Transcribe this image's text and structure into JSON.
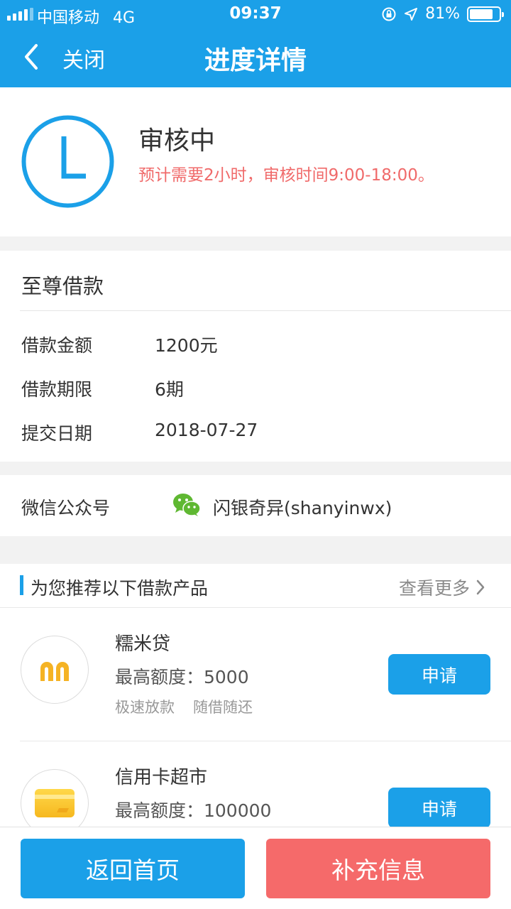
{
  "status_bar": {
    "carrier": "中国移动",
    "network": "4G",
    "time": "09:37",
    "battery": "81%",
    "battery_level": 0.81
  },
  "nav": {
    "close_label": "关闭",
    "title": "进度详情"
  },
  "status": {
    "title": "审核中",
    "note": "预计需要2小时，审核时间9:00-18:00。",
    "note_color": "#f06a6a"
  },
  "loan": {
    "title": "至尊借款",
    "rows": [
      {
        "label": "借款金额",
        "value": "1200元"
      },
      {
        "label": "借款期限",
        "value": "6期"
      },
      {
        "label": "提交日期",
        "value": "2018-07-27"
      }
    ]
  },
  "wechat": {
    "label": "微信公众号",
    "value": "闪银奇异(shanyinwx)",
    "icon": "wechat-icon"
  },
  "recommend": {
    "title": "为您推荐以下借款产品",
    "more": "查看更多",
    "products": [
      {
        "name": "糯米贷",
        "limit": "最高额度：5000",
        "tags": [
          "极速放款",
          "随借随还"
        ],
        "apply": "申请",
        "icon": "nuomi-logo-icon"
      },
      {
        "name": "信用卡超市",
        "limit": "最高额度：100000",
        "apply": "申请",
        "icon": "credit-card-icon"
      }
    ]
  },
  "footer": {
    "home_label": "返回首页",
    "supplement_label": "补充信息"
  },
  "colors": {
    "primary": "#1ba0e8",
    "danger": "#f56a6a",
    "background": "#f2f2f2"
  }
}
